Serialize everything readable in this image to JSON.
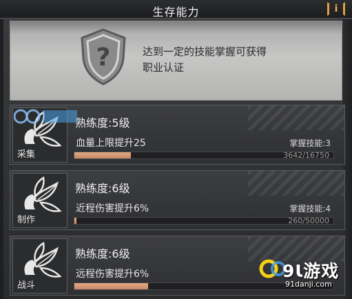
{
  "header": {
    "title": "生存能力",
    "info_label": "i"
  },
  "certification": {
    "line1": "达到一定的技能掌握可获得",
    "line2": "职业认证",
    "icon": "shield-question-icon"
  },
  "skills": [
    {
      "name": "采集",
      "icon": "leaf-hand-icon",
      "level": "熟练度:5级",
      "bonus": "血量上限提升25",
      "mastery": "掌握技能:3",
      "progress_text": "3642/16750",
      "progress": 0.217
    },
    {
      "name": "制作",
      "icon": "leaf-hand-icon",
      "level": "熟练度:6级",
      "bonus": "近程伤害提升6%",
      "mastery": "掌握技能:4",
      "progress_text": "260/50000",
      "progress": 0.005
    },
    {
      "name": "战斗",
      "icon": "leaf-hand-icon",
      "level": "熟练度:6级",
      "bonus": "远程伤害提升6%",
      "mastery": "",
      "progress_text": "",
      "progress": 0.285
    }
  ],
  "watermark": {
    "brand": "9Ɩ游戏",
    "url": "91danji.com"
  },
  "colors": {
    "accent": "#e0a040",
    "bar": "#d69a76",
    "panel": "#bcbcbb"
  }
}
